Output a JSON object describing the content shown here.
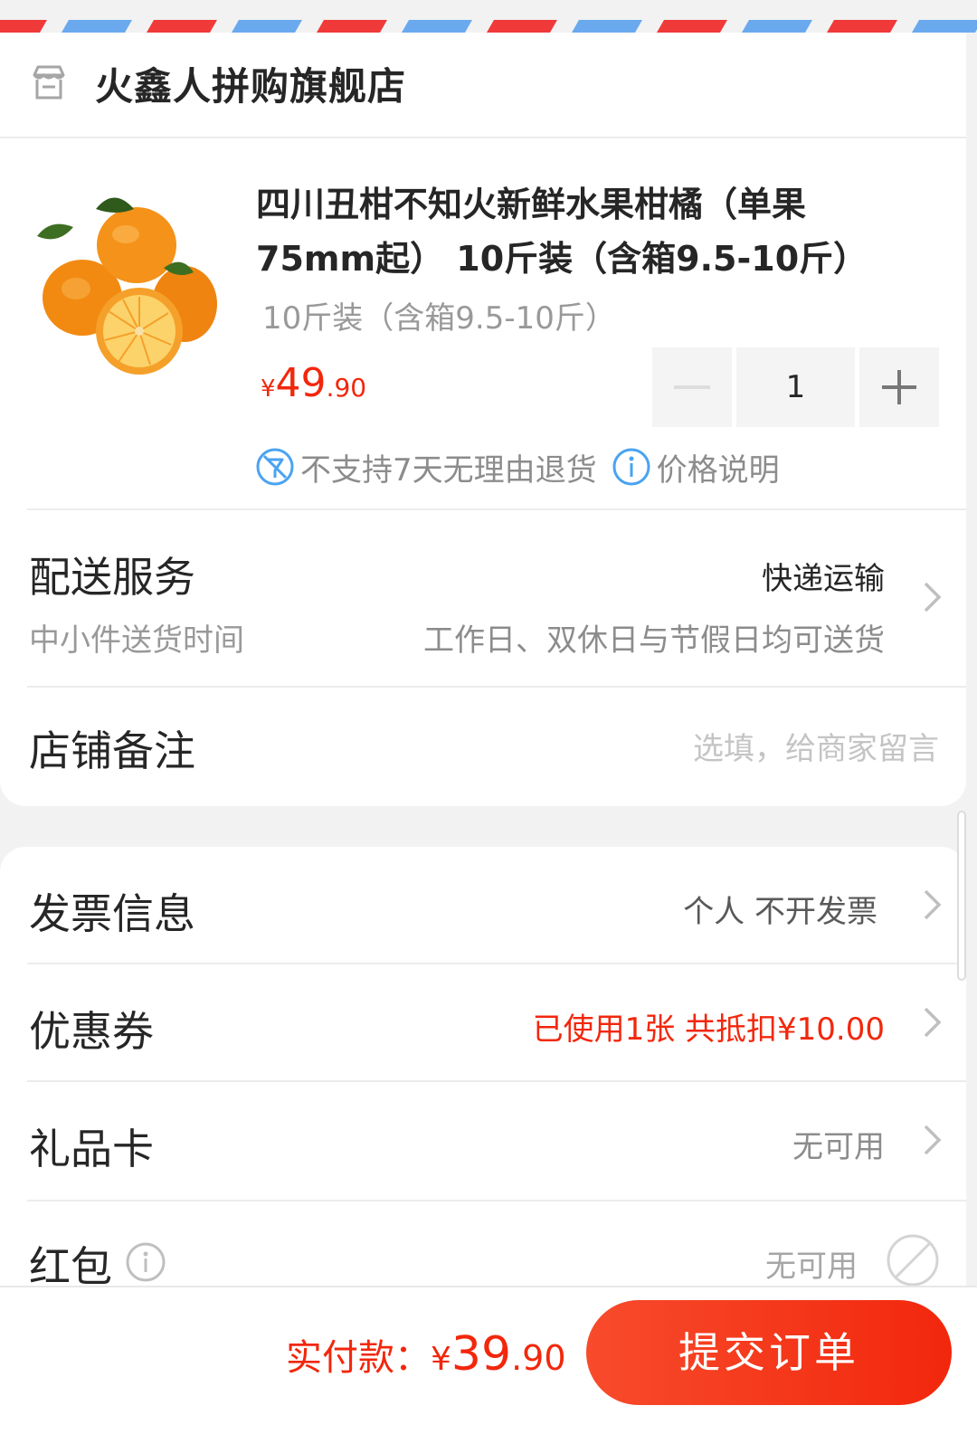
{
  "store": {
    "name": "火鑫人拼购旗舰店",
    "icon": "store-icon"
  },
  "product": {
    "title": "四川丑柑不知火新鲜水果柑橘（单果75mm起） 10斤装（含箱9.5-10斤）",
    "spec": "10斤装（含箱9.5-10斤）",
    "price_symbol": "¥",
    "price_int": "49",
    "price_dec": ".90",
    "quantity": "1",
    "image": "oranges-product-image"
  },
  "notices": {
    "no_return": "不支持7天无理由退货",
    "price_note": "价格说明"
  },
  "delivery": {
    "title": "配送服务",
    "method": "快递运输",
    "sub_label": "中小件送货时间",
    "sub_value": "工作日、双休日与节假日均可送货"
  },
  "remark": {
    "title": "店铺备注",
    "placeholder": "选填，给商家留言"
  },
  "invoice": {
    "title": "发票信息",
    "value": "个人 不开发票"
  },
  "coupon": {
    "title": "优惠券",
    "value": "已使用1张 共抵扣¥10.00"
  },
  "giftcard": {
    "title": "礼品卡",
    "value": "无可用"
  },
  "redpacket": {
    "title": "红包",
    "value": "无可用"
  },
  "footer": {
    "pay_label": "实付款：",
    "currency": "¥",
    "total_int": "39",
    "total_dec": ".90",
    "submit": "提交订单"
  },
  "colors": {
    "accent": "#f2270c",
    "info_blue": "#4aa3f2"
  }
}
